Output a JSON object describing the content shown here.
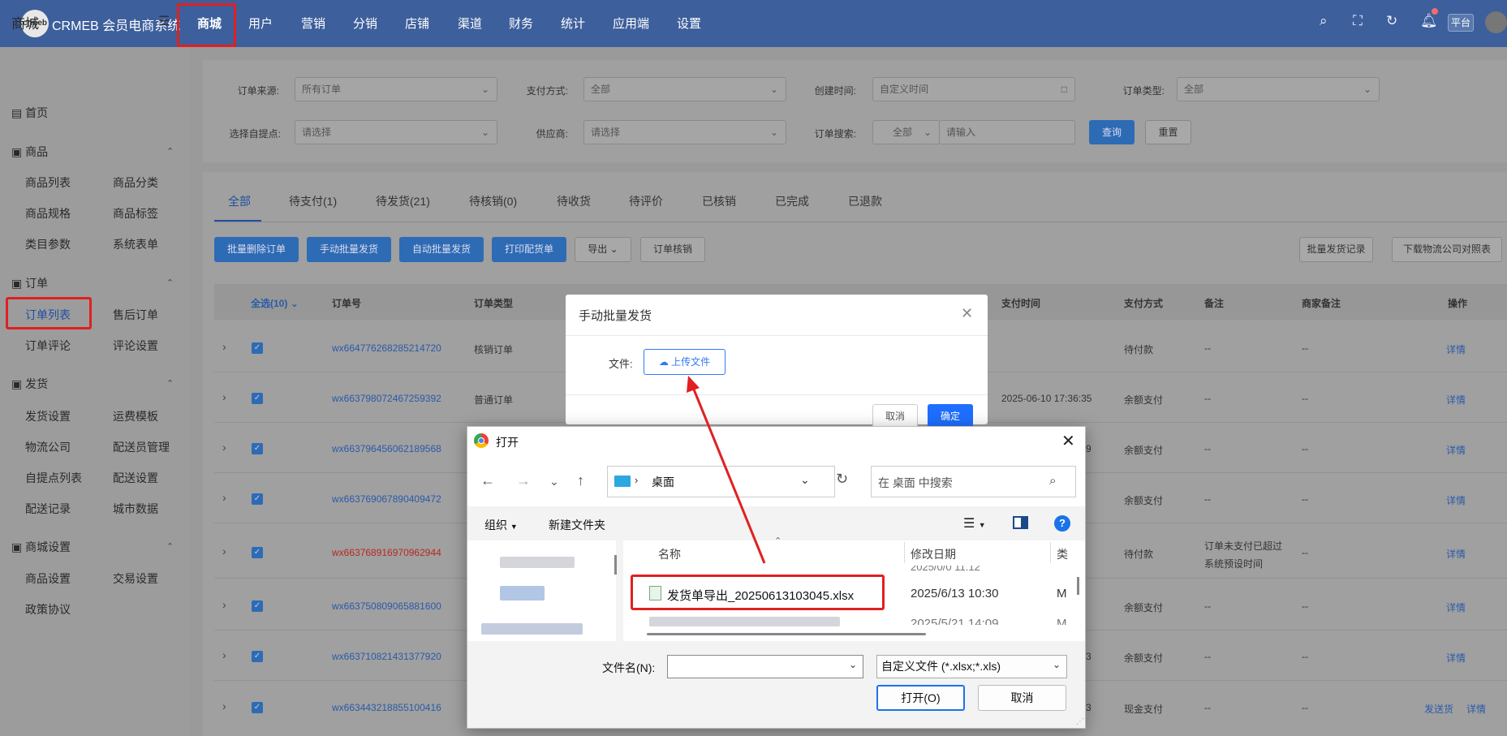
{
  "topbar": {
    "logo_text": "crmeb",
    "brand": "CRMEB 会员电商系统",
    "nav": [
      "商城",
      "用户",
      "营销",
      "分销",
      "店铺",
      "渠道",
      "财务",
      "统计",
      "应用端",
      "设置"
    ],
    "active_nav": "商城",
    "platform_tag": "平台",
    "icons": [
      "search-icon",
      "fullscreen-icon",
      "refresh-icon",
      "bell-icon"
    ]
  },
  "sidebar": {
    "title": "商城",
    "collapse_icon": "menu-fold-icon",
    "home": "首页",
    "groups": [
      {
        "label": "商品",
        "items": [
          "商品列表",
          "商品分类",
          "商品规格",
          "商品标签",
          "类目参数",
          "系统表单"
        ]
      },
      {
        "label": "订单",
        "items": [
          "订单列表",
          "售后订单",
          "订单评论",
          "评论设置"
        ]
      },
      {
        "label": "发货",
        "items": [
          "发货设置",
          "运费模板",
          "物流公司",
          "配送员管理",
          "自提点列表",
          "配送设置",
          "配送记录",
          "城市数据"
        ]
      },
      {
        "label": "商城设置",
        "items": [
          "商品设置",
          "交易设置",
          "政策协议"
        ]
      }
    ],
    "active_item": "订单列表"
  },
  "filters": {
    "order_source_label": "订单来源:",
    "order_source_value": "所有订单",
    "pay_method_label": "支付方式:",
    "pay_method_value": "全部",
    "create_time_label": "创建时间:",
    "create_time_placeholder": "自定义时间",
    "order_type_label": "订单类型:",
    "order_type_value": "全部",
    "pickup_label": "选择自提点:",
    "pickup_placeholder": "请选择",
    "supplier_label": "供应商:",
    "supplier_placeholder": "请选择",
    "search_label": "订单搜索:",
    "search_scope": "全部",
    "search_placeholder": "请输入",
    "query_btn": "查询",
    "reset_btn": "重置"
  },
  "tabs": [
    "全部",
    "待支付(1)",
    "待发货(21)",
    "待核销(0)",
    "待收货",
    "待评价",
    "已核销",
    "已完成",
    "已退款"
  ],
  "actions": {
    "batch_delete": "批量删除订单",
    "manual_ship": "手动批量发货",
    "auto_ship": "自动批量发货",
    "print": "打印配货单",
    "export": "导出",
    "verify": "订单核销",
    "ship_records": "批量发货记录",
    "download_logistics": "下载物流公司对照表"
  },
  "table": {
    "headers": [
      "全选(10)",
      "订单号",
      "订单类型",
      "支付时间",
      "支付方式",
      "备注",
      "商家备注",
      "操作"
    ],
    "rows": [
      {
        "order_no": "wx664776268285214720",
        "type": "核销订单",
        "pay_time": "",
        "pay_method": "待付款",
        "note": "--",
        "merchant_note": "--",
        "ops": [
          "详情"
        ],
        "red": false
      },
      {
        "order_no": "wx663798072467259392",
        "type": "普通订单",
        "pay_time": "2025-06-10 17:36:35",
        "pay_method": "余额支付",
        "note": "--",
        "merchant_note": "--",
        "ops": [
          "详情"
        ],
        "red": false
      },
      {
        "order_no": "wx663796456062189568",
        "type": "",
        "pay_time": "9",
        "pay_method": "余额支付",
        "note": "--",
        "merchant_note": "--",
        "ops": [
          "详情"
        ],
        "red": false
      },
      {
        "order_no": "wx663769067890409472",
        "type": "",
        "pay_time": "",
        "pay_method": "余额支付",
        "note": "--",
        "merchant_note": "--",
        "ops": [
          "详情"
        ],
        "red": false
      },
      {
        "order_no": "wx663768916970962944",
        "type": "",
        "pay_time": "",
        "pay_method": "待付款",
        "note": "订单未支付已超过系统预设时间",
        "merchant_note": "--",
        "ops": [
          "详情"
        ],
        "red": true
      },
      {
        "order_no": "wx663750809065881600",
        "type": "",
        "pay_time": "",
        "pay_method": "余额支付",
        "note": "--",
        "merchant_note": "--",
        "ops": [
          "详情"
        ],
        "red": false
      },
      {
        "order_no": "wx663710821431377920",
        "type": "",
        "pay_time": "3",
        "pay_method": "余额支付",
        "note": "--",
        "merchant_note": "--",
        "ops": [
          "详情"
        ],
        "red": false
      },
      {
        "order_no": "wx663443218855100416",
        "type": "",
        "pay_time": "3",
        "pay_method": "现金支付",
        "note": "--",
        "merchant_note": "--",
        "ops": [
          "发送货",
          "详情"
        ],
        "red": false
      }
    ]
  },
  "modal": {
    "title": "手动批量发货",
    "file_label": "文件:",
    "upload_btn": "上传文件",
    "cancel": "取消",
    "confirm": "确定"
  },
  "file_dialog": {
    "title": "打开",
    "path_location": "桌面",
    "search_placeholder": "在 桌面 中搜索",
    "organize": "组织",
    "new_folder": "新建文件夹",
    "col_name": "名称",
    "col_date": "修改日期",
    "col_type": "类",
    "prev_date_partial": "2025/0/0 11.12",
    "file_name": "发货单导出_20250613103045.xlsx",
    "file_date": "2025/6/13 10:30",
    "file_type_partial": "M",
    "next_date_partial": "2025/5/21 14:09",
    "next_type_partial": "M",
    "filename_label": "文件名(N):",
    "filename_value": "",
    "filter": "自定义文件 (*.xlsx;*.xls)",
    "open_btn": "打开(O)",
    "cancel_btn": "取消"
  },
  "colors": {
    "topbar": "#3d5f9c",
    "highlight_red": "#e02020",
    "primary": "#1e6fff"
  }
}
